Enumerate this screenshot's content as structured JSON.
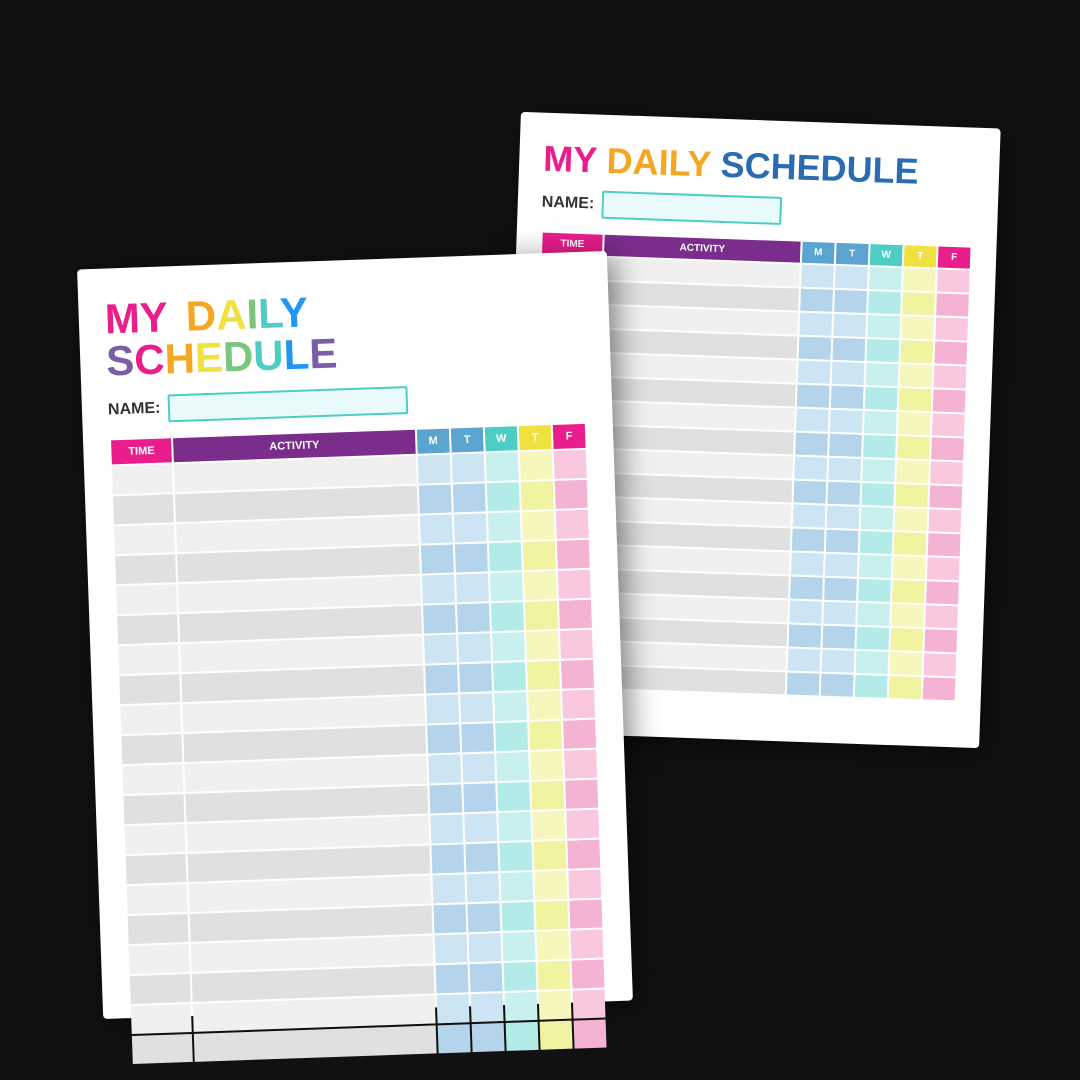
{
  "cards": {
    "title_line1": "MY DAILY",
    "title_line2": "SCHEDULE",
    "name_label": "NAME:",
    "table": {
      "headers": [
        "TIME",
        "ACTIVITY",
        "M",
        "T",
        "W",
        "T",
        "F"
      ],
      "row_count": 18
    }
  }
}
